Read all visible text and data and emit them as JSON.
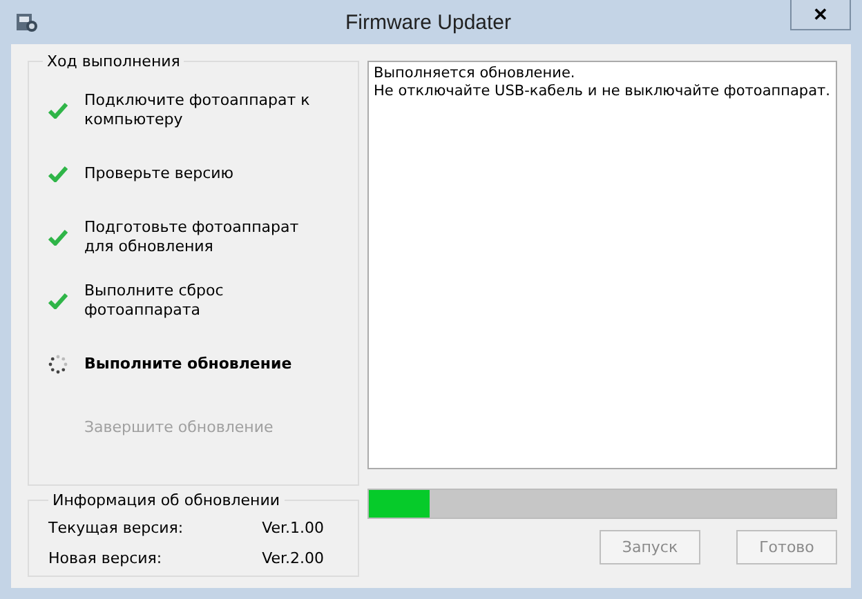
{
  "window": {
    "title": "Firmware Updater",
    "close": "✕"
  },
  "progress": {
    "title": "Ход выполнения",
    "steps": [
      {
        "label": "Подключите фотоаппарат к компьютеру",
        "kind": "done"
      },
      {
        "label": "Проверьте версию",
        "kind": "done"
      },
      {
        "label": "Подготовьте фотоаппарат для обновления",
        "kind": "done"
      },
      {
        "label": "Выполните сброс фотоаппарата",
        "kind": "done"
      },
      {
        "label": "Выполните обновление",
        "kind": "active"
      },
      {
        "label": "Завершите обновление",
        "kind": "pending"
      }
    ]
  },
  "log": {
    "lines": [
      "Выполняется обновление.",
      "Не отключайте USB-кабель и не выключайте фотоаппарат."
    ]
  },
  "info": {
    "title": "Информация об обновлении",
    "rows": [
      {
        "label": "Текущая версия:",
        "value": "Ver.1.00"
      },
      {
        "label": "Новая версия:",
        "value": "Ver.2.00"
      }
    ]
  },
  "progress_bar": {
    "level": 0.13
  },
  "buttons": [
    {
      "label": "Запуск",
      "disabled": true
    },
    {
      "label": "Готово",
      "disabled": true
    }
  ]
}
